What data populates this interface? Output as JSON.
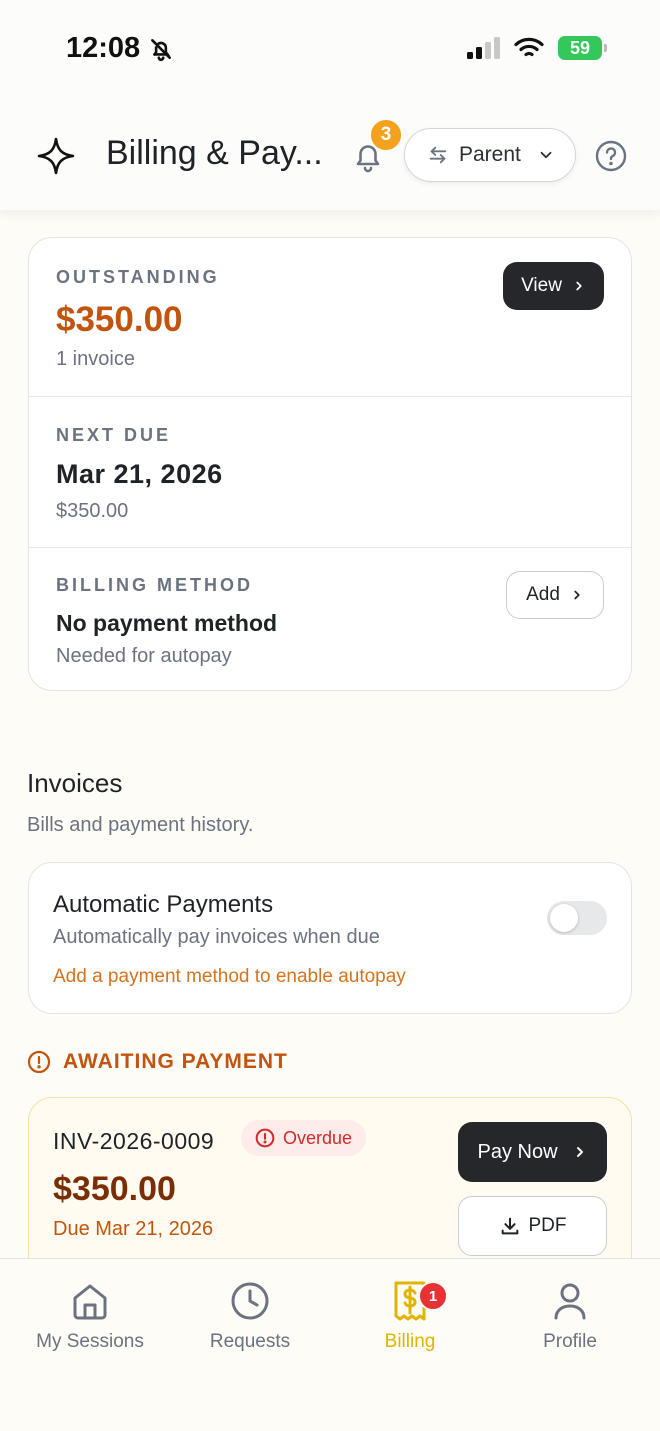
{
  "status_bar": {
    "time": "12:08",
    "battery": "59"
  },
  "header": {
    "title": "Billing & Pay...",
    "notification_count": "3",
    "role_label": "Parent"
  },
  "summary": {
    "outstanding": {
      "label": "OUTSTANDING",
      "amount": "$350.00",
      "count": "1 invoice",
      "view_label": "View"
    },
    "next_due": {
      "label": "NEXT DUE",
      "date": "Mar 21, 2026",
      "amount": "$350.00"
    },
    "billing_method": {
      "label": "BILLING METHOD",
      "title": "No payment method",
      "subtitle": "Needed for autopay",
      "add_label": "Add"
    }
  },
  "invoices": {
    "title": "Invoices",
    "subtitle": "Bills and payment history.",
    "autopay": {
      "title": "Automatic Payments",
      "subtitle": "Automatically pay invoices when due",
      "warning": "Add a payment method to enable autopay",
      "enabled": false
    },
    "awaiting_label": "AWAITING PAYMENT",
    "items": [
      {
        "number": "INV-2026-0009",
        "status": "Overdue",
        "amount": "$350.00",
        "due": "Due Mar 21, 2026",
        "pay_label": "Pay Now",
        "pdf_label": "PDF"
      }
    ]
  },
  "tabbar": {
    "items": [
      {
        "label": "My Sessions",
        "icon": "home-icon"
      },
      {
        "label": "Requests",
        "icon": "clock-icon"
      },
      {
        "label": "Billing",
        "icon": "receipt-dollar-icon",
        "badge": "1",
        "active": true
      },
      {
        "label": "Profile",
        "icon": "user-icon"
      }
    ]
  },
  "colors": {
    "accent_orange": "#c2540e",
    "warning_orange": "#d7731e",
    "active_tab": "#e2b400",
    "badge_red": "#e63232",
    "badge_yellow": "#f4a21b"
  }
}
